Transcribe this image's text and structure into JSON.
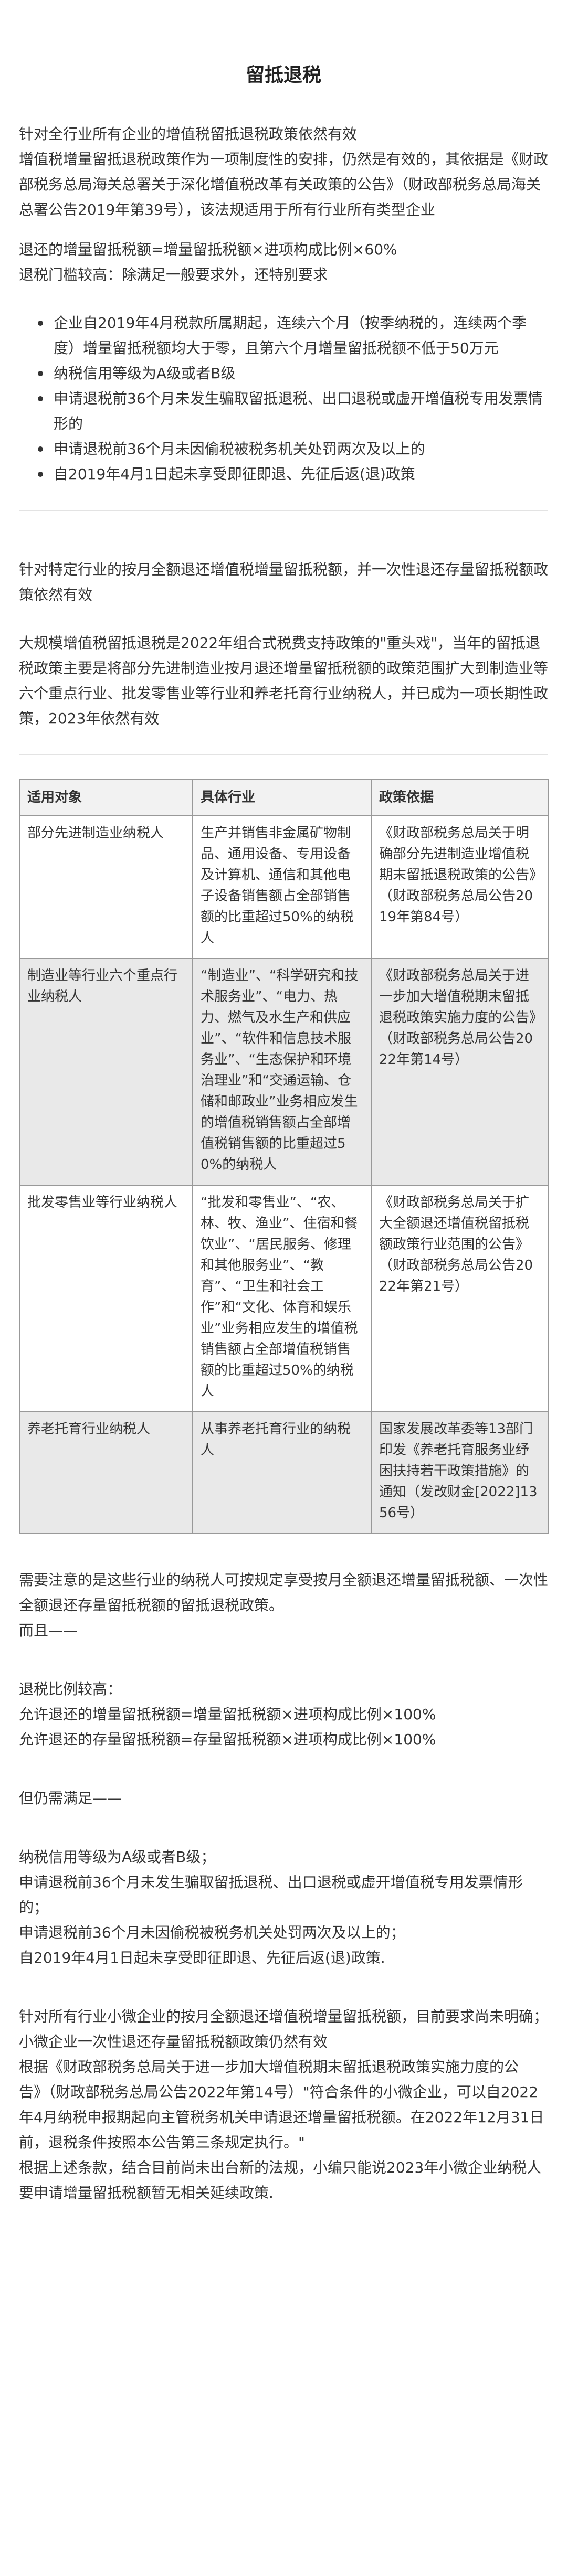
{
  "title": "留抵退税",
  "section1": {
    "intro": "针对全行业所有企业的增值税留抵退税政策依然有效",
    "body": "增值税增量留抵退税政策作为一项制度性的安排，仍然是有效的，其依据是《财政部税务总局海关总署关于深化增值税改革有关政策的公告》（财政部税务总局海关总署公告2019年第39号），该法规适用于所有行业所有类型企业",
    "formula": "退还的增量留抵税额=增量留抵税额×进项构成比例×60%",
    "threshold": "退税门槛较高：除满足一般要求外，还特别要求",
    "conditions": [
      "企业自2019年4月税款所属期起，连续六个月（按季纳税的，连续两个季度）增量留抵税额均大于零，且第六个月增量留抵税额不低于50万元",
      "纳税信用等级为A级或者B级",
      "申请退税前36个月未发生骗取留抵退税、出口退税或虚开增值税专用发票情形的",
      "申请退税前36个月未因偷税被税务机关处罚两次及以上的",
      "自2019年4月1日起未享受即征即退、先征后返(退)政策"
    ]
  },
  "section2": {
    "intro": "针对特定行业的按月全额退还增值税增量留抵税额，并一次性退还存量留抵税额政策依然有效",
    "body": "大规模增值税留抵退税是2022年组合式税费支持政策的\"重头戏\"，当年的留抵退税政策主要是将部分先进制造业按月退还增量留抵税额的政策范围扩大到制造业等六个重点行业、批发零售业等行业和养老托育行业纳税人，并已成为一项长期性政策，2023年依然有效"
  },
  "table": {
    "headers": [
      "适用对象",
      "具体行业",
      "政策依据"
    ],
    "rows": [
      {
        "target": "部分先进制造业纳税人",
        "industry": "生产并销售非金属矿物制品、通用设备、专用设备及计算机、通信和其他电子设备销售额占全部销售额的比重超过50%的纳税人",
        "basis": "《财政部税务总局关于明确部分先进制造业增值税期末留抵退税政策的公告》（财政部税务总局公告2019年第84号）",
        "shaded": false
      },
      {
        "target": "制造业等行业六个重点行业纳税人",
        "industry": "“制造业”、“科学研究和技术服务业”、“电力、热力、燃气及水生产和供应业”、“软件和信息技术服务业”、“生态保护和环境治理业”和“交通运输、仓储和邮政业”业务相应发生的增值税销售额占全部增值税销售额的比重超过50%的纳税人",
        "basis": "《财政部税务总局关于进一步加大增值税期末留抵退税政策实施力度的公告》（财政部税务总局公告2022年第14号）",
        "shaded": true
      },
      {
        "target": "批发零售业等行业纳税人",
        "industry": "“批发和零售业”、“农、林、牧、渔业”、住宿和餐饮业”、“居民服务、修理和其他服务业”、“教育”、“卫生和社会工作”和“文化、体育和娱乐业”业务相应发生的增值税销售额占全部增值税销售额的比重超过50%的纳税人",
        "basis": "《财政部税务总局关于扩大全额退还增值税留抵税额政策行业范围的公告》（财政部税务总局公告2022年第21号）",
        "shaded": false
      },
      {
        "target": "养老托育行业纳税人",
        "industry": "从事养老托育行业的纳税人",
        "basis": "国家发展改革委等13部门印发《养老托育服务业纾困扶持若干政策措施》的通知（发改财金[2022]1356号）",
        "shaded": true
      }
    ]
  },
  "section3": {
    "note": "需要注意的是这些行业的纳税人可按规定享受按月全额退还增量留抵税额、一次性全额退还存量留抵税额的留抵退税政策。",
    "and": "而且——",
    "ratio_title": "退税比例较高：",
    "ratio_lines": [
      "允许退还的增量留抵税额=增量留抵税额×进项构成比例×100%",
      "允许退还的存量留抵税额=存量留抵税额×进项构成比例×100%"
    ],
    "still": "但仍需满足——",
    "requirements": [
      "纳税信用等级为A级或者B级；",
      "申请退税前36个月未发生骗取留抵退税、出口退税或虚开增值税专用发票情形的；",
      "申请退税前36个月未因偷税被税务机关处罚两次及以上的；",
      "自2019年4月1日起未享受即征即退、先征后返(退)政策."
    ]
  },
  "section4": {
    "intro": "针对所有行业小微企业的按月全额退还增值税增量留抵税额，目前要求尚未明确；小微企业一次性退还存量留抵税额政策仍然有效",
    "basis": "根据《财政部税务总局关于进一步加大增值税期末留抵退税政策实施力度的公告》（财政部税务总局公告2022年第14号）\"符合条件的小微企业，可以自2022年4月纳税申报期起向主管税务机关申请退还增量留抵税额。在2022年12月31日前，退税条件按照本公告第三条规定执行。\"",
    "conclusion": "根据上述条款，结合目前尚未出台新的法规，小编只能说2023年小微企业纳税人要申请增量留抵税额暂无相关延续政策."
  }
}
